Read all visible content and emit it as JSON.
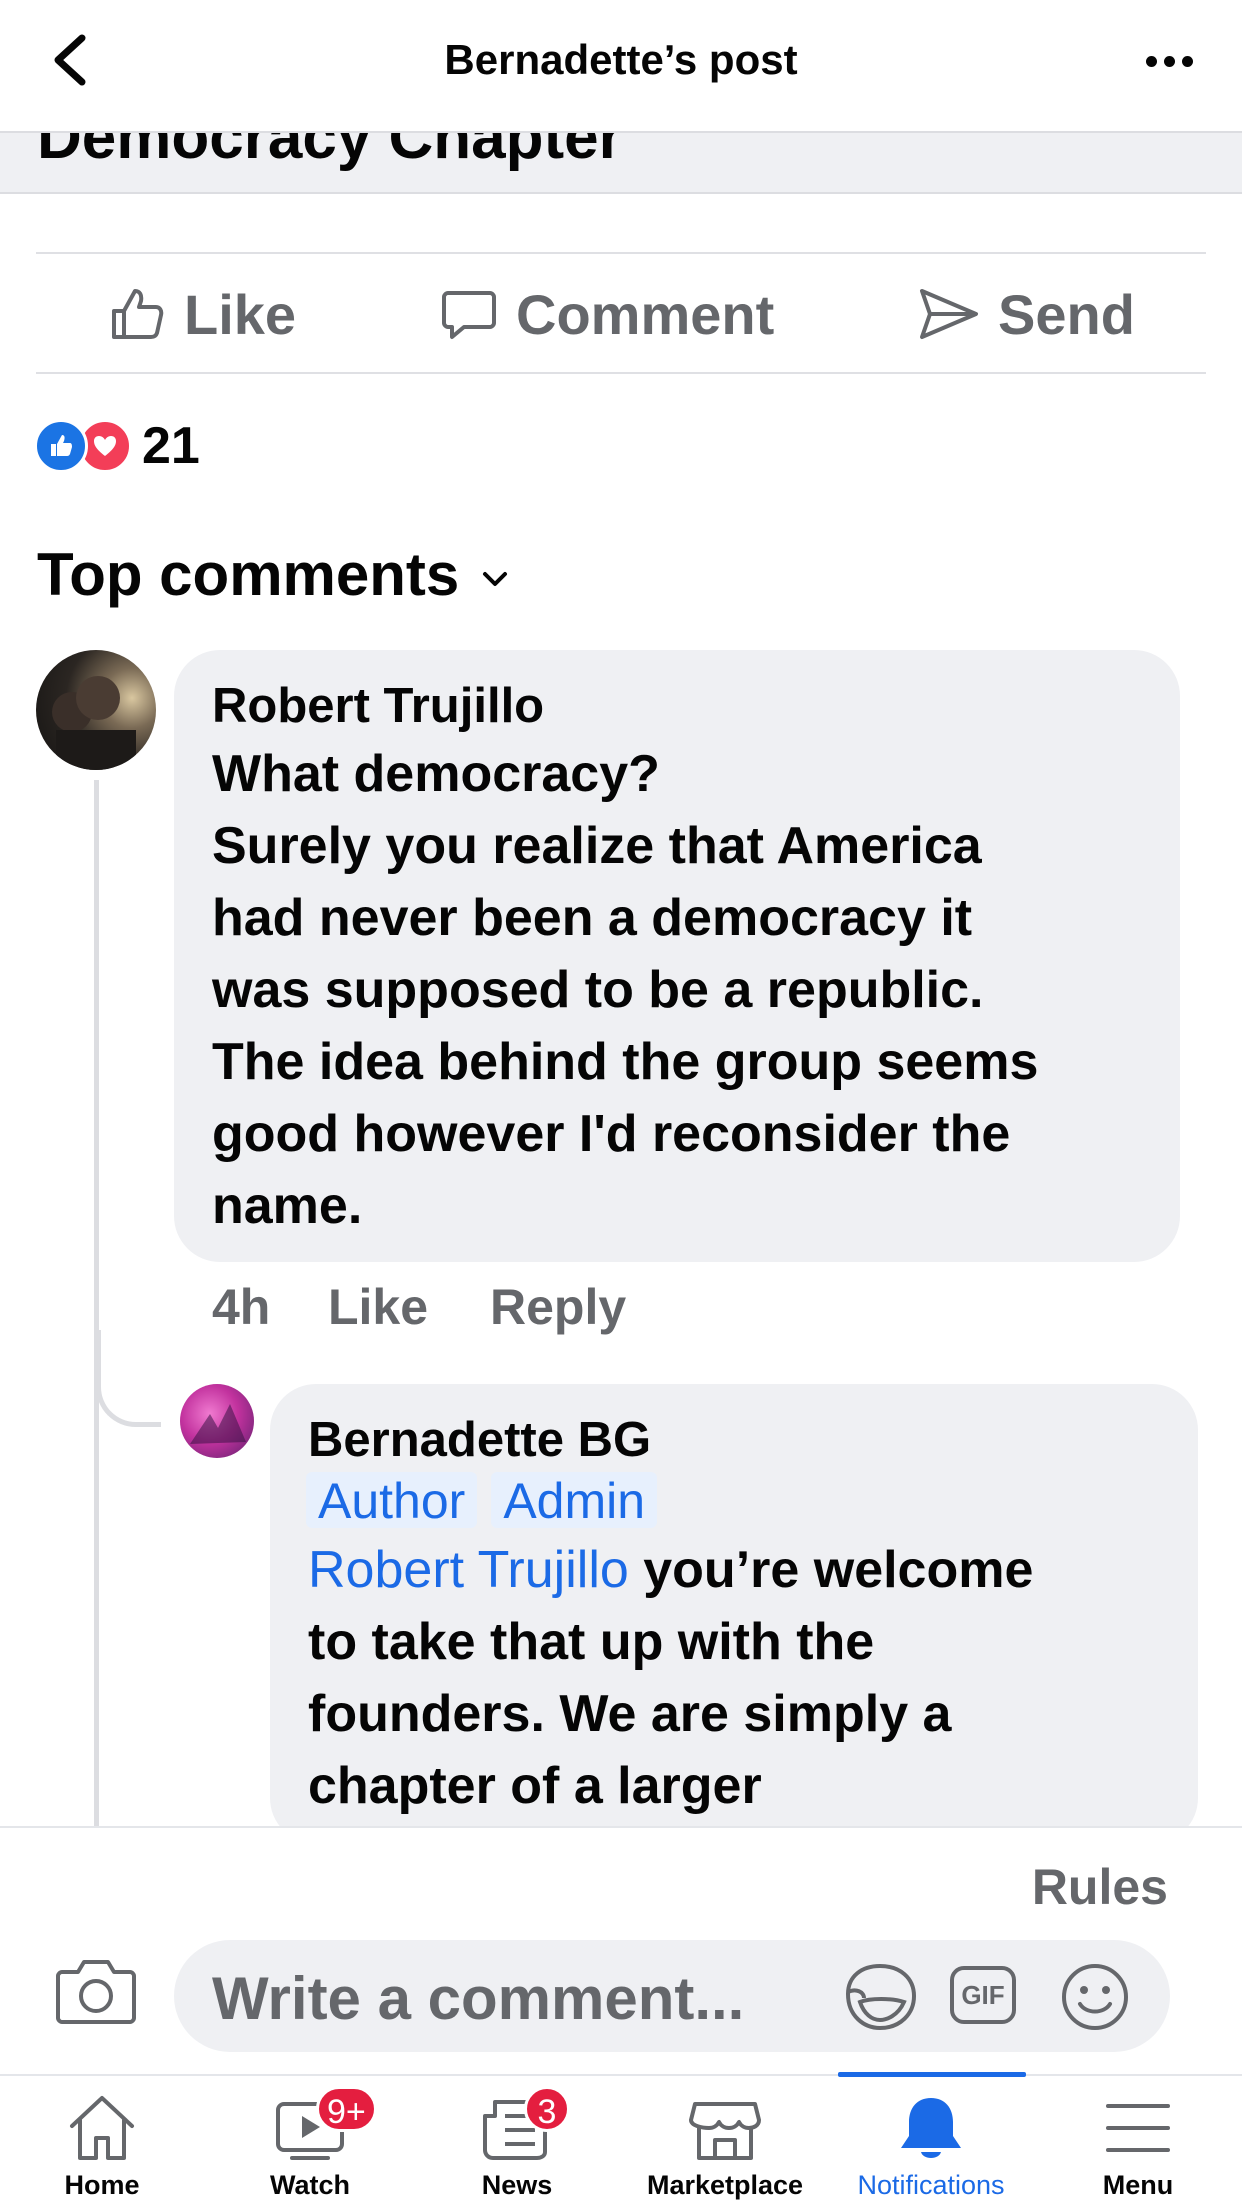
{
  "header": {
    "title": "Bernadette’s post",
    "group_name": "Democracy Chapter"
  },
  "actions": {
    "like": "Like",
    "comment": "Comment",
    "send": "Send"
  },
  "reactions": {
    "count": "21",
    "types": [
      "like",
      "love"
    ]
  },
  "comments_section": {
    "sort_label": "Top comments"
  },
  "comments": [
    {
      "author": "Robert Trujillo",
      "lines": [
        "What democracy?",
        "Surely you realize that America",
        "had never been a democracy it",
        "was supposed to be a republic.",
        "The idea behind the group seems",
        "good however I'd reconsider the",
        "name."
      ],
      "time": "4h",
      "like_label": "Like",
      "reply_label": "Reply"
    }
  ],
  "reply": {
    "author": "Bernadette BG",
    "badges": [
      "Author",
      "Admin"
    ],
    "mention": "Robert Trujillo",
    "lines": [
      " you’re welcome",
      "to take that up with the",
      "founders. We are simply a",
      "chapter of a larger"
    ]
  },
  "composer": {
    "rules_label": "Rules",
    "placeholder": "Write a comment...",
    "gif_label": "GIF"
  },
  "tabbar": {
    "items": [
      {
        "label": "Home",
        "icon": "home-icon"
      },
      {
        "label": "Watch",
        "icon": "watch-icon",
        "badge": "9+"
      },
      {
        "label": "News",
        "icon": "news-icon",
        "badge": "3"
      },
      {
        "label": "Marketplace",
        "icon": "marketplace-icon"
      },
      {
        "label": "Notifications",
        "icon": "bell-icon",
        "active": true
      },
      {
        "label": "Menu",
        "icon": "menu-icon"
      }
    ]
  },
  "colors": {
    "accent_blue": "#1b6ae6",
    "badge_red": "#e41e3f",
    "bubble_gray": "#eff0f3",
    "secondary_text": "#65676b"
  }
}
